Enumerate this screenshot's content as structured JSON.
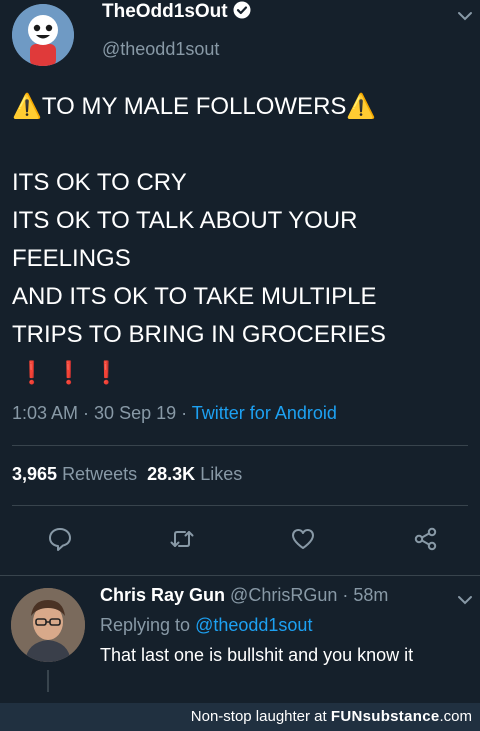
{
  "tweet": {
    "author": {
      "name": "TheOdd1sOut",
      "handle": "@theodd1sout",
      "verified": true
    },
    "text": {
      "warning_emoji": "⚠️",
      "heading": "TO MY MALE FOLLOWERS",
      "lines": [
        "ITS OK TO CRY",
        "ITS OK TO TALK ABOUT YOUR",
        "FEELINGS",
        "AND ITS OK TO TAKE MULTIPLE",
        "TRIPS TO BRING IN GROCERIES"
      ],
      "exclamations": "❗❗❗"
    },
    "meta": {
      "time": "1:03 AM",
      "date": "30 Sep 19",
      "separator": " · ",
      "source": "Twitter for Android"
    },
    "stats": {
      "retweets_count": "3,965",
      "retweets_label": "Retweets",
      "likes_count": "28.3K",
      "likes_label": "Likes"
    },
    "action_icons": [
      "reply-icon",
      "retweet-icon",
      "like-icon",
      "share-icon"
    ]
  },
  "reply": {
    "name": "Chris Ray Gun",
    "handle": "@ChrisRGun",
    "age": "58m",
    "replying_prefix": "Replying to",
    "replying_to": "@theodd1sout",
    "text": "That last one is bullshit and you know it"
  },
  "watermark": {
    "prefix": "Non-stop laughter at",
    "brand": "FUNsubstance",
    "suffix": ".com"
  },
  "colors": {
    "background": "#15202b",
    "text": "#ffffff",
    "secondary": "#8899a6",
    "link": "#1da1f2",
    "divider": "#38444d",
    "footer": "#203040"
  }
}
